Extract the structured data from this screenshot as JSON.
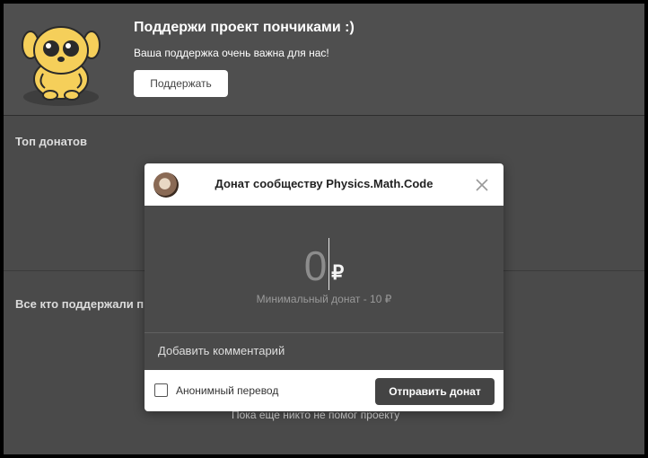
{
  "banner": {
    "title": "Поддержи проект пончиками :)",
    "subtitle": "Ваша поддержка очень важна для нас!",
    "support_button": "Поддержать"
  },
  "page": {
    "top_donations_title": "Топ донатов",
    "supporters_title": "Все кто поддержали п",
    "empty_text": "Пока еще никто не помог проекту"
  },
  "modal": {
    "title": "Донат сообществу Physics.Math.Code",
    "amount": "0",
    "currency_symbol": "₽",
    "min_donation": "Минимальный донат - 10 ₽",
    "comment_label": "Добавить комментарий",
    "anonymous_label": "Анонимный перевод",
    "anonymous_checked": false,
    "send_button": "Отправить донат"
  },
  "icons": {
    "mascot": "dog-mascot-icon",
    "close": "close-icon",
    "avatar": "community-avatar"
  },
  "colors": {
    "background": "#4a4a4a",
    "modal_header": "#ffffff",
    "send_button": "#444444"
  }
}
